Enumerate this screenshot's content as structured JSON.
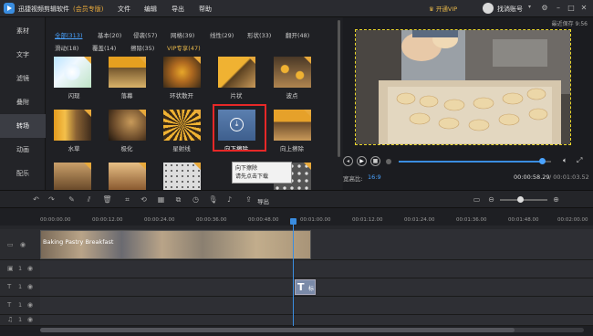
{
  "titlebar": {
    "app_title": "迅捷视频剪辑软件",
    "edition": "(会员专版)",
    "menu": [
      "文件",
      "编辑",
      "导出",
      "帮助"
    ],
    "vip_label": "开通VIP",
    "account_label": "找淌账号",
    "recent_save": "最近保存 9:56"
  },
  "sidebar": {
    "items": [
      {
        "label": "素材",
        "active": false
      },
      {
        "label": "文字",
        "active": false
      },
      {
        "label": "滤镜",
        "active": false
      },
      {
        "label": "叠附",
        "active": false
      },
      {
        "label": "转场",
        "active": true
      },
      {
        "label": "动画",
        "active": false
      },
      {
        "label": "配乐",
        "active": false
      }
    ]
  },
  "library": {
    "categories_row1": [
      "全部(313)",
      "基本(20)",
      "侵袭(57)",
      "网格(39)",
      "线性(29)",
      "形状(33)",
      "翻开(48)"
    ],
    "categories_row2": [
      "滑动(18)",
      "覆盖(14)",
      "擦除(35)",
      "VIP专享(47)"
    ],
    "row1_labels": [
      "闪现",
      "落幕",
      "环状散开",
      "片状",
      "波点"
    ],
    "row2_labels": [
      "水草",
      "极化",
      "星射线",
      "向下擦除",
      "向上擦除"
    ],
    "selected_label": "向下擦除",
    "tooltip_line1": "向下擦除",
    "tooltip_line2": "请先点击下载"
  },
  "preview": {
    "aspect_label": "宽高比:",
    "aspect_value": "16:9",
    "current_time": "00:00:58.29",
    "total_time": "/ 00:01:03.52",
    "progress": 0.94
  },
  "toolbar": {
    "export_label": "导出"
  },
  "timeline": {
    "ticks": [
      "00:00:00.00",
      "00:00:12.00",
      "00:00:24.00",
      "00:00:36.00",
      "00:00:48.00",
      "00:01:00.00",
      "00:01:12.00",
      "00:01:24.00",
      "00:01:36.00",
      "00:01:48.00",
      "00:02:00.00"
    ],
    "clip_title": "Baking Pastry Breakfast",
    "track_labels": [
      "1",
      "1",
      "1",
      "1"
    ],
    "text_clip_label": "标"
  },
  "colors": {
    "accent": "#3a8de0",
    "vip": "#e8b84a",
    "highlight": "#e62828",
    "video_border": "#e9d62a"
  }
}
